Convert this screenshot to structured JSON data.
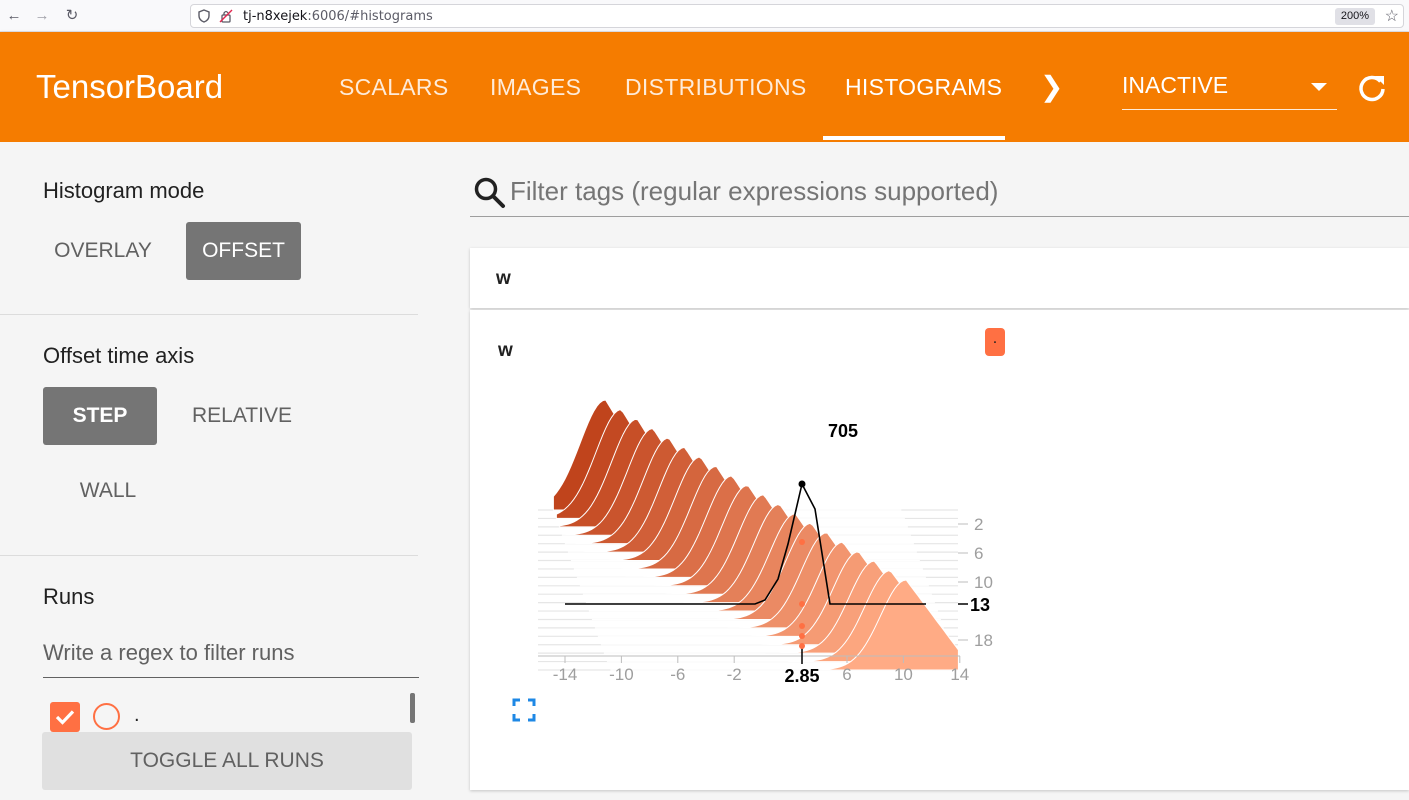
{
  "browser": {
    "url_host": "tj-n8xejek",
    "url_rest": ":6006/#histograms",
    "zoom": "200%"
  },
  "header": {
    "brand": "TensorBoard",
    "tabs": [
      {
        "label": "SCALARS",
        "active": false
      },
      {
        "label": "IMAGES",
        "active": false
      },
      {
        "label": "DISTRIBUTIONS",
        "active": false
      },
      {
        "label": "HISTOGRAMS",
        "active": true
      }
    ],
    "plugin_select": "INACTIVE",
    "accent": "#f57c00"
  },
  "sidebar": {
    "histogram_mode_title": "Histogram mode",
    "histogram_modes": [
      {
        "label": "OVERLAY",
        "selected": false
      },
      {
        "label": "OFFSET",
        "selected": true
      }
    ],
    "offset_axis_title": "Offset time axis",
    "offset_axes": [
      {
        "label": "STEP",
        "selected": true
      },
      {
        "label": "RELATIVE",
        "selected": false
      },
      {
        "label": "WALL",
        "selected": false
      }
    ],
    "runs_title": "Runs",
    "run_filter_placeholder": "Write a regex to filter runs",
    "runs": [
      {
        "name": ".",
        "checked": true,
        "color": "#ff7043"
      }
    ],
    "toggle_all_label": "TOGGLE ALL RUNS"
  },
  "main": {
    "tag_filter_placeholder": "Filter tags (regular expressions supported)",
    "group_label": "w",
    "card": {
      "title": "w",
      "run_chip": "."
    }
  },
  "chart_data": {
    "type": "histogram-offset",
    "run": ".",
    "x_ticks": [
      "-14",
      "-10",
      "-6",
      "-2",
      "6",
      "10",
      "14"
    ],
    "y_ticks": [
      "2",
      "6",
      "10",
      "18"
    ],
    "xlim": [
      -14,
      14
    ],
    "steps": 20,
    "hover": {
      "x": "2.85",
      "step": "13",
      "count": "705"
    },
    "colors": {
      "oldest": "#c0441c",
      "newest": "#ffab85"
    },
    "series_shape": {
      "peak_start_x": -10.5,
      "peak_end_x": 10.5,
      "spread": 2.2
    }
  }
}
